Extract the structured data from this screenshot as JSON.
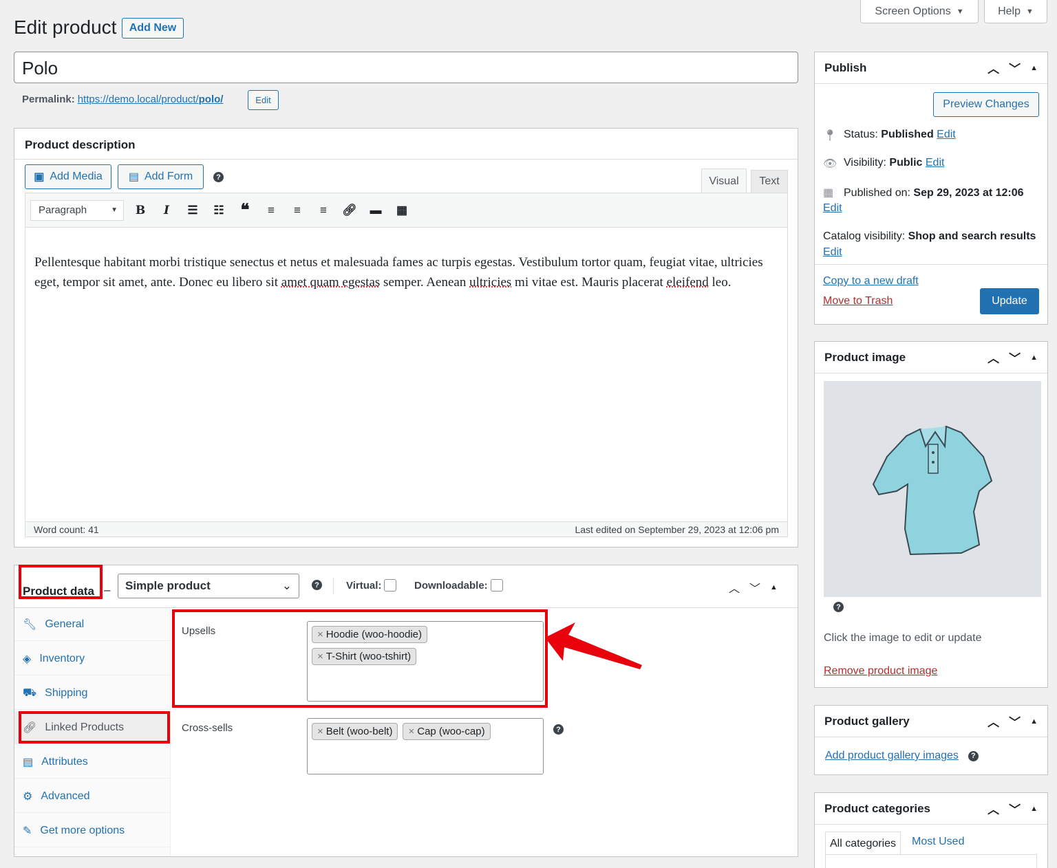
{
  "header": {
    "title": "Edit product",
    "add_new": "Add New",
    "screen_options": "Screen Options",
    "help": "Help"
  },
  "product": {
    "title": "Polo",
    "permalink_label": "Permalink:",
    "permalink_base": "https://demo.local/product/",
    "permalink_slug": "polo/",
    "permalink_edit": "Edit"
  },
  "description": {
    "heading": "Product description",
    "add_media": "Add Media",
    "add_form": "Add Form",
    "tab_visual": "Visual",
    "tab_text": "Text",
    "format": "Paragraph",
    "body_before": "Pellentesque habitant morbi tristique senectus et netus et malesuada fames ac turpis egestas. Vestibulum tortor quam, feugiat vitae, ultricies eget, tempor sit amet, ante. Donec eu libero sit ",
    "body_sp1": "amet quam egestas",
    "body_mid": " semper. Aenean ",
    "body_sp2": "ultricies",
    "body_mid2": " mi vitae est. Mauris placerat ",
    "body_sp3": "eleifend",
    "body_after": " leo.",
    "word_count": "Word count: 41",
    "last_edited": "Last edited on September 29, 2023 at 12:06 pm"
  },
  "product_data": {
    "heading": "Product data",
    "dash": "–",
    "type": "Simple product",
    "virtual": "Virtual:",
    "downloadable": "Downloadable:",
    "tabs": [
      {
        "label": "General",
        "icon": "wrench-icon"
      },
      {
        "label": "Inventory",
        "icon": "tag-icon"
      },
      {
        "label": "Shipping",
        "icon": "truck-icon"
      },
      {
        "label": "Linked Products",
        "icon": "link-icon"
      },
      {
        "label": "Attributes",
        "icon": "list-icon"
      },
      {
        "label": "Advanced",
        "icon": "gear-icon"
      },
      {
        "label": "Get more options",
        "icon": "plugin-icon"
      }
    ],
    "upsells_label": "Upsells",
    "upsells": [
      "Hoodie (woo-hoodie)",
      "T-Shirt (woo-tshirt)"
    ],
    "crosssells_label": "Cross-sells",
    "crosssells": [
      "Belt (woo-belt)",
      "Cap (woo-cap)"
    ],
    "remove_x": "×"
  },
  "publish": {
    "heading": "Publish",
    "preview": "Preview Changes",
    "status_label": "Status:",
    "status_value": "Published",
    "edit": "Edit",
    "visibility_label": "Visibility:",
    "visibility_value": "Public",
    "published_label": "Published on:",
    "published_value": "Sep 29, 2023 at 12:06",
    "catalog_label": "Catalog visibility:",
    "catalog_value": "Shop and search results",
    "copy_draft": "Copy to a new draft",
    "trash": "Move to Trash",
    "update": "Update"
  },
  "product_image": {
    "heading": "Product image",
    "hint": "Click the image to edit or update",
    "remove": "Remove product image"
  },
  "gallery": {
    "heading": "Product gallery",
    "add": "Add product gallery images"
  },
  "categories": {
    "heading": "Product categories",
    "tab_all": "All categories",
    "tab_used": "Most Used"
  },
  "help_mark": "?",
  "colors": {
    "accent": "#2271b1",
    "highlight": "#e8000b",
    "trash": "#b32d2e"
  }
}
